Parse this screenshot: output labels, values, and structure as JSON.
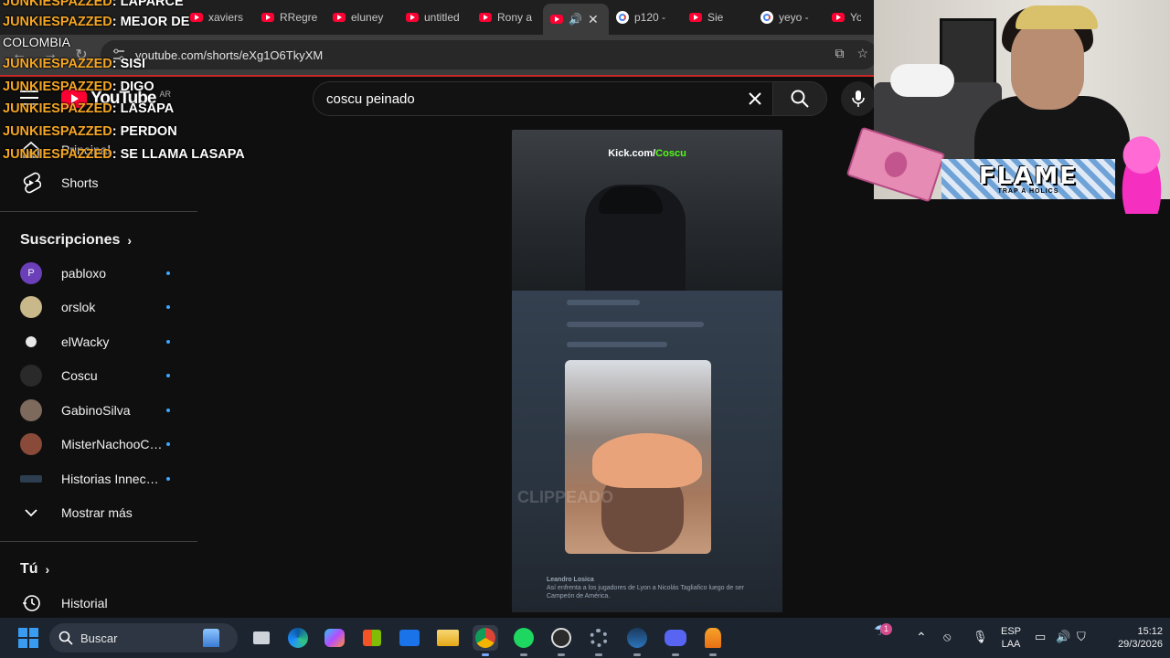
{
  "browser": {
    "tabs": [
      {
        "label": "xaviers",
        "icon": "youtube-icon"
      },
      {
        "label": "RRegre",
        "icon": "youtube-icon"
      },
      {
        "label": "eluney",
        "icon": "youtube-icon"
      },
      {
        "label": "untitled",
        "icon": "youtube-icon"
      },
      {
        "label": "Rony a",
        "icon": "youtube-icon"
      },
      {
        "label": "",
        "icon": "youtube-icon"
      },
      {
        "label": "p120 -",
        "icon": "google-icon"
      },
      {
        "label": "Sie",
        "icon": "youtube-icon"
      },
      {
        "label": "yeyo -",
        "icon": "google-icon"
      },
      {
        "label": "Yo",
        "icon": "youtube-icon"
      }
    ],
    "url": "youtube.com/shorts/eXg1O6TkyXM"
  },
  "youtube": {
    "logo_text": "YouTube",
    "country_code": "AR",
    "search_value": "coscu peinado",
    "sidebar": {
      "main": [
        {
          "label": "Principal",
          "icon": "home-icon"
        },
        {
          "label": "Shorts",
          "icon": "shorts-icon"
        }
      ],
      "subscriptions_title": "Suscripciones",
      "subscriptions": [
        {
          "label": "pabloxo",
          "avatar_color": "#6a3fb8",
          "initial": "P"
        },
        {
          "label": "orslok",
          "avatar_color": "#c9b98a",
          "initial": ""
        },
        {
          "label": "elWacky",
          "avatar_color": "#e8e8e8",
          "initial": ""
        },
        {
          "label": "Coscu",
          "avatar_color": "#2a2a2a",
          "initial": ""
        },
        {
          "label": "GabinoSilva",
          "avatar_color": "#7d6a5c",
          "initial": ""
        },
        {
          "label": "MisterNachooCli...",
          "avatar_color": "#8a4a3a",
          "initial": ""
        },
        {
          "label": "Historias Innece...",
          "avatar_color": "#2c3e50",
          "initial": ""
        }
      ],
      "show_more": "Mostrar más",
      "you_title": "Tú",
      "history": "Historial"
    },
    "short": {
      "watermark_prefix": "Kick.com/",
      "watermark_name": "Coscu",
      "clip_text": "CLIPPEADO",
      "footer_handle": "Leandro Losica",
      "footer_text": "Así enfrenta a los jugadores de Lyon a Nicolás Tagliafico luego de ser Campeón de América."
    }
  },
  "chat": {
    "lines": [
      {
        "user": "JUNKIESPAZZED",
        "msg": "LAPARCE"
      },
      {
        "user": "JUNKIESPAZZED",
        "msg": "MEJOR DE"
      },
      {
        "user": "",
        "msg": "COLOMBIA"
      },
      {
        "user": "JUNKIESPAZZED",
        "msg": "SISI"
      },
      {
        "user": "JUNKIESPAZZED",
        "msg": "DIGO"
      },
      {
        "user": "JUNKIESPAZZED",
        "msg": "LASAPA"
      },
      {
        "user": "JUNKIESPAZZED",
        "msg": "PERDON"
      },
      {
        "user": "JUNKIESPAZZED",
        "msg": "SE LLAMA LASAPA"
      }
    ]
  },
  "overlay": {
    "banner_title": "FLAME",
    "banner_sub": "TRAP A HOLICS"
  },
  "taskbar": {
    "search_label": "Buscar",
    "language": "ESP",
    "layout": "LAA",
    "time": "15:12",
    "date": "29/3/2026",
    "notification_count": "1",
    "apps": [
      "files-icon",
      "edge-icon",
      "copilot-icon",
      "store-icon",
      "outlook-icon",
      "explorer-icon",
      "chrome-icon",
      "spotify-icon",
      "obs-icon",
      "settings-icon",
      "steam-icon",
      "discord-icon",
      "fl-studio-icon"
    ]
  }
}
